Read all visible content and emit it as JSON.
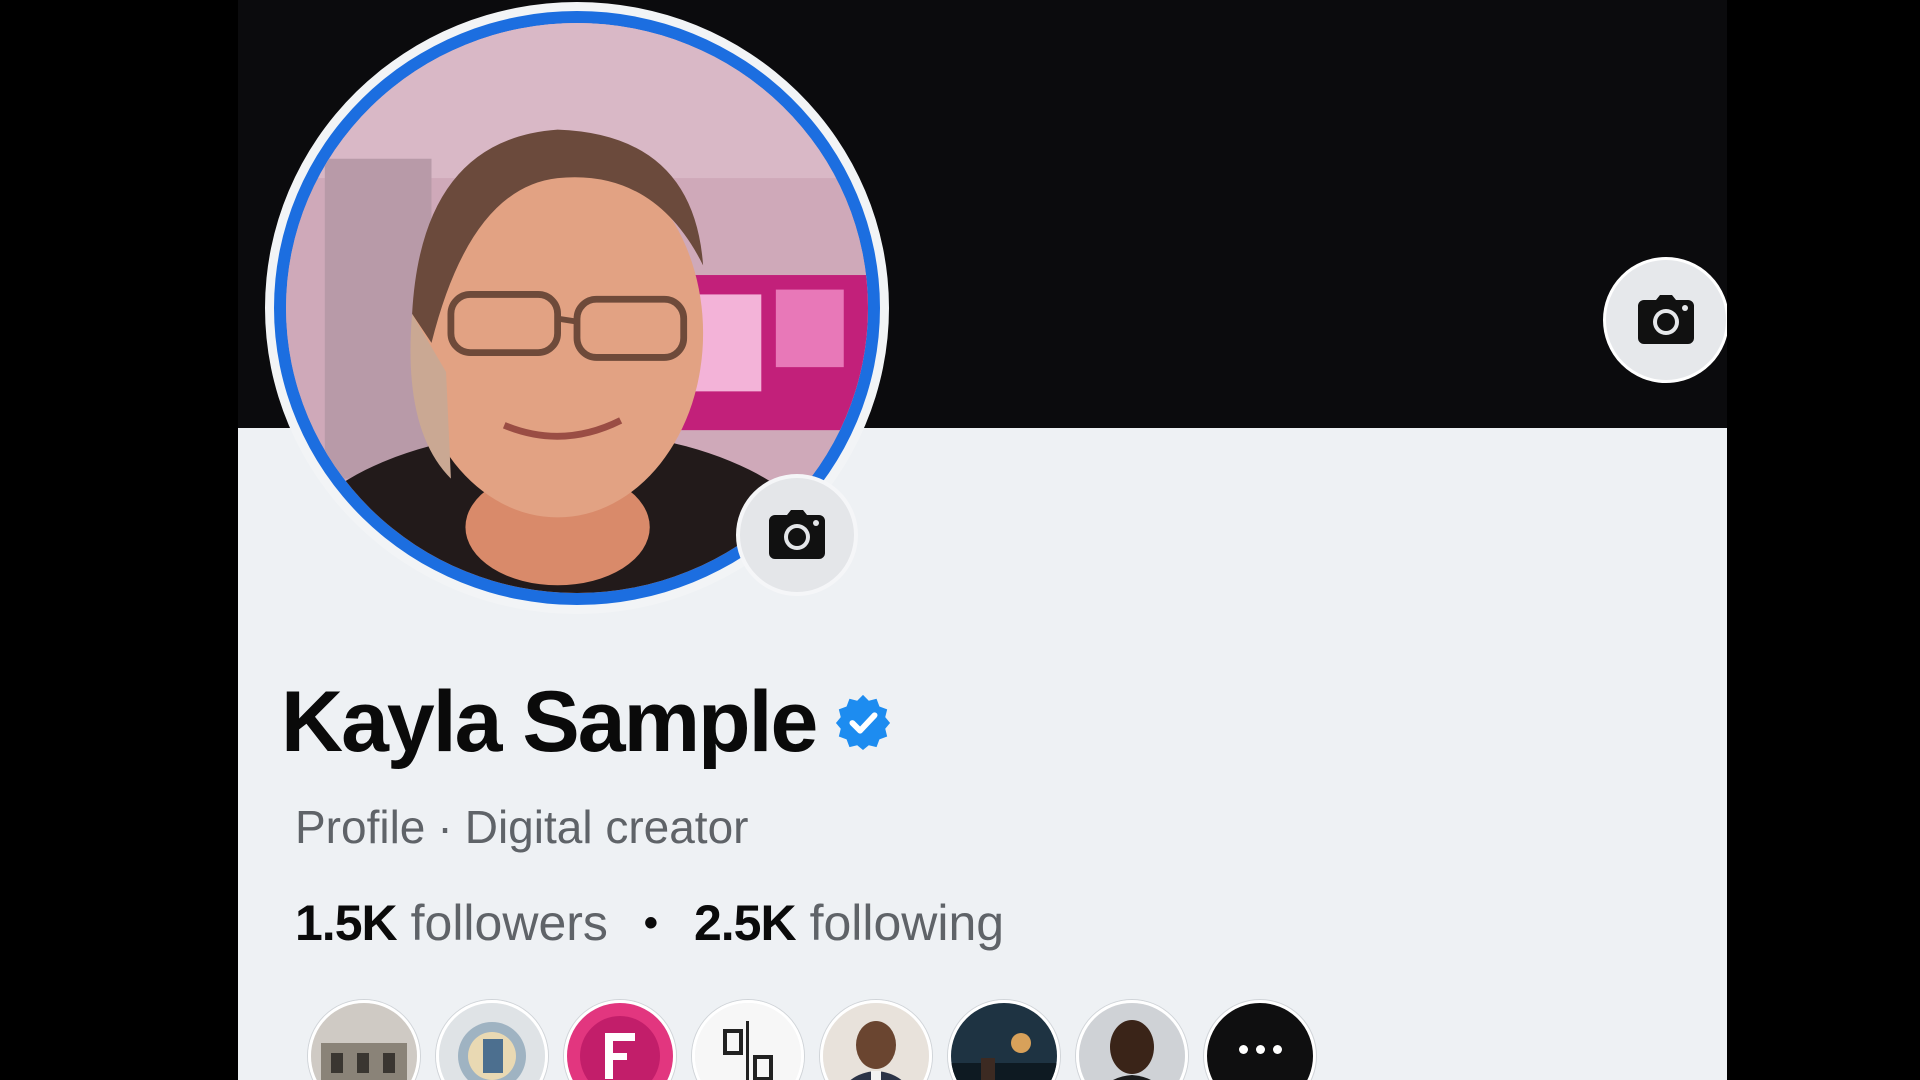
{
  "profile": {
    "name": "Kayla Sample",
    "category_prefix": "Profile",
    "separator": "·",
    "category": "Digital creator",
    "verified": true
  },
  "stats": {
    "followers_count": "1.5K",
    "followers_label": "followers",
    "separator": "•",
    "following_count": "2.5K",
    "following_label": "following"
  },
  "icons": {
    "cover_camera": "camera-icon",
    "avatar_camera": "camera-icon",
    "verified": "verified-badge-icon",
    "more": "more-dots-icon"
  },
  "colors": {
    "accent": "#1c6ee0",
    "verified": "#1d8cf0",
    "cover": "#0b0b0d",
    "background": "#eef1f4"
  },
  "friends": [
    {
      "style": "building"
    },
    {
      "style": "logo-e"
    },
    {
      "style": "logo-f"
    },
    {
      "style": "logo-sc"
    },
    {
      "style": "person-suit"
    },
    {
      "style": "poster"
    },
    {
      "style": "person-portrait"
    }
  ]
}
